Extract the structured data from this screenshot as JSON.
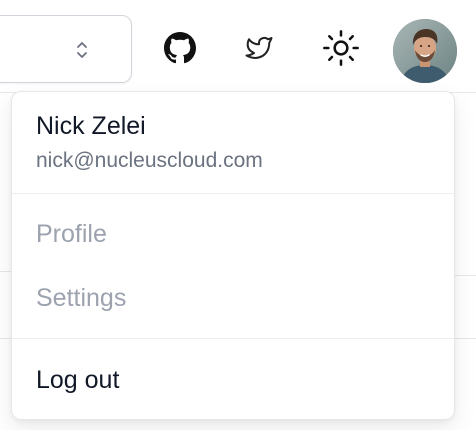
{
  "header": {
    "select": {
      "value": ""
    },
    "icons": {
      "github": "github-icon",
      "twitter": "twitter-icon",
      "theme": "sun-icon",
      "chevron": "chevron-up-down-icon"
    }
  },
  "user_menu": {
    "name": "Nick Zelei",
    "email": "nick@nucleuscloud.com",
    "items": [
      {
        "label": "Profile",
        "state": "disabled"
      },
      {
        "label": "Settings",
        "state": "disabled"
      },
      {
        "label": "Log out",
        "state": "enabled"
      }
    ]
  },
  "colors": {
    "text_primary": "#111827",
    "text_secondary": "#6b7280",
    "text_disabled": "#9ca3af",
    "border": "#e5e7eb"
  }
}
